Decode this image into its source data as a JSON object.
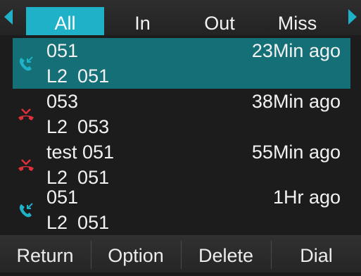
{
  "tabs": [
    {
      "label": "All",
      "active": true
    },
    {
      "label": "In",
      "active": false
    },
    {
      "label": "Out",
      "active": false
    },
    {
      "label": "Miss",
      "active": false
    }
  ],
  "calls": [
    {
      "name": "051",
      "time": "23Min ago",
      "line": "L2",
      "number": "051",
      "type": "received",
      "icon": "phone-received-icon",
      "selected": true
    },
    {
      "name": "053",
      "time": "38Min ago",
      "line": "L2",
      "number": "053",
      "type": "missed",
      "icon": "phone-missed-icon",
      "selected": false
    },
    {
      "name": "test 051",
      "time": "55Min ago",
      "line": "L2",
      "number": "051",
      "type": "missed",
      "icon": "phone-missed-icon",
      "selected": false
    },
    {
      "name": "051",
      "time": "1Hr ago",
      "line": "L2",
      "number": "051",
      "type": "received",
      "icon": "phone-received-icon",
      "selected": false
    }
  ],
  "softkeys": {
    "return": "Return",
    "option": "Option",
    "delete": "Delete",
    "dial": "Dial"
  },
  "colors": {
    "accent": "#1fb1c7",
    "selected_row": "#156f77",
    "received": "#1fb1c7",
    "missed": "#e0303a"
  }
}
